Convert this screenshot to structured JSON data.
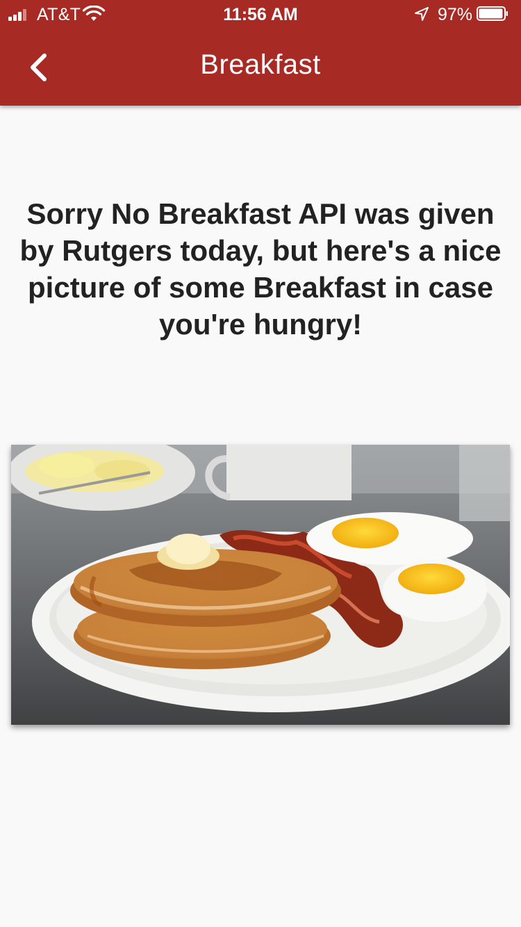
{
  "status_bar": {
    "carrier": "AT&T",
    "time": "11:56 AM",
    "battery_percent": "97%",
    "battery_level": 0.97,
    "icons": [
      "signal-bars-icon",
      "wifi-icon",
      "location-arrow-icon",
      "battery-icon"
    ]
  },
  "nav": {
    "title": "Breakfast",
    "back_icon": "chevron-left-icon"
  },
  "main": {
    "message": "Sorry No Breakfast API was given by Rutgers today, but here's a nice picture of some Breakfast in case you're hungry!",
    "image_subject": "pancakes-bacon-eggs"
  },
  "colors": {
    "header": "#a82a24",
    "background": "#f9f9f9",
    "text": "#222222"
  }
}
